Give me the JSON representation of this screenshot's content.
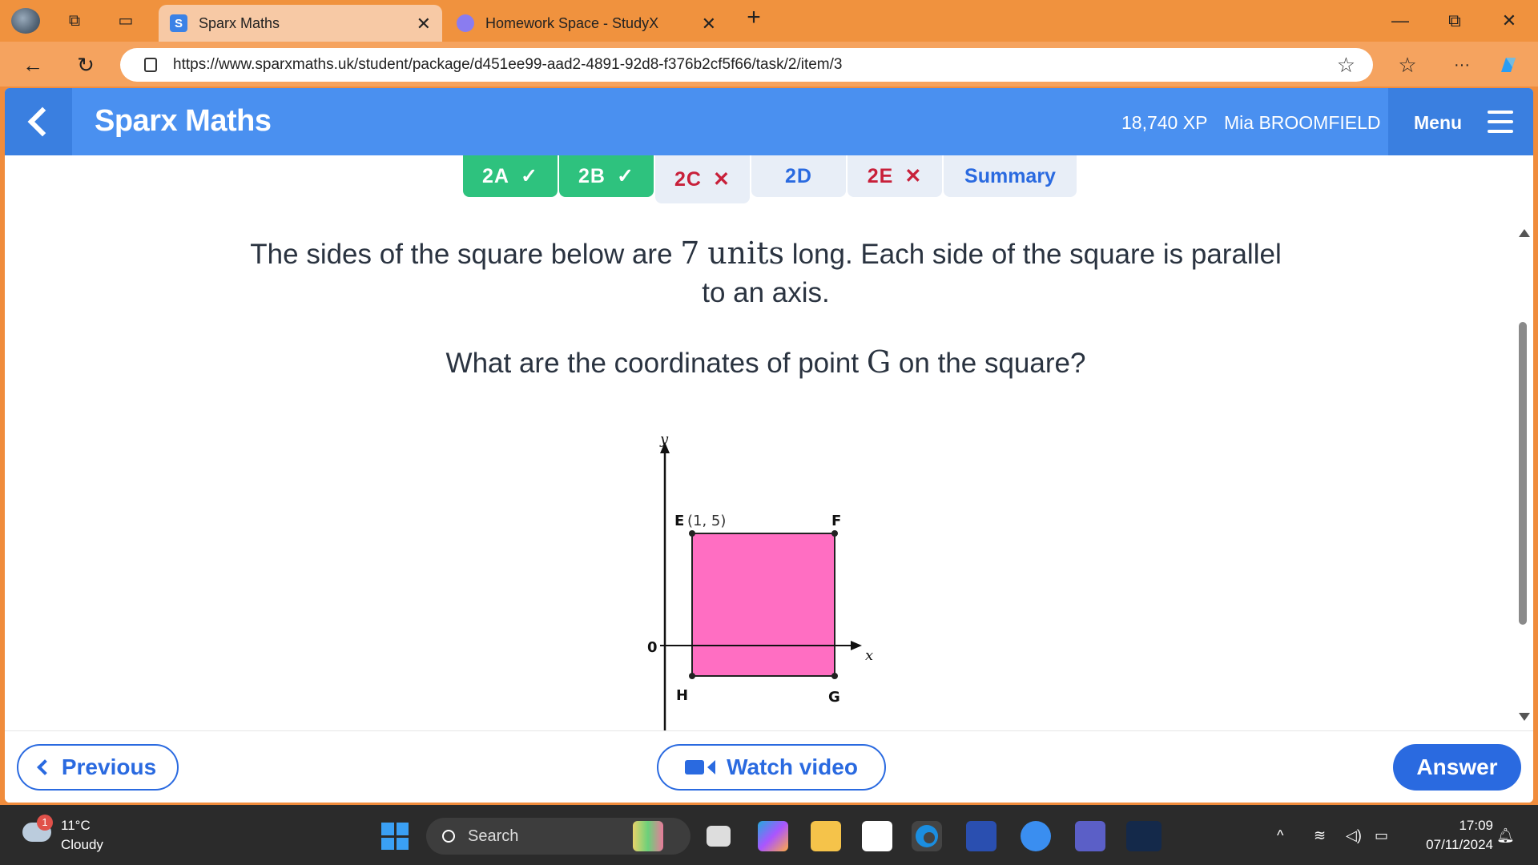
{
  "browser": {
    "tabs": [
      {
        "title": "Sparx Maths",
        "favicon": "S",
        "active": true
      },
      {
        "title": "Homework Space - StudyX",
        "active": false
      }
    ],
    "new_tab": "+",
    "url": "https://www.sparxmaths.uk/student/package/d451ee99-aad2-4891-92d8-f376b2cf5f66/task/2/item/3"
  },
  "app": {
    "brand": "Sparx Maths",
    "xp": "18,740 XP",
    "user": "Mia BROOMFIELD",
    "menu_label": "Menu"
  },
  "task_tabs": [
    {
      "label": "2A",
      "status": "done",
      "mark": "✓"
    },
    {
      "label": "2B",
      "status": "done",
      "mark": "✓"
    },
    {
      "label": "2C",
      "status": "wrong",
      "mark": "✕"
    },
    {
      "label": "2D",
      "status": "plain",
      "mark": ""
    },
    {
      "label": "2E",
      "status": "wrong",
      "mark": "✕"
    },
    {
      "label": "Summary",
      "status": "plain",
      "mark": ""
    }
  ],
  "question": {
    "line1_pre": "The sides of the square below are ",
    "line1_num": "7",
    "line1_unit": "units",
    "line1_post": " long. Each side of the square is parallel",
    "line2": "to an axis.",
    "q_pre": "What are the coordinates of point ",
    "q_point": "G",
    "q_post": " on the square?"
  },
  "diagram": {
    "y_axis": "y",
    "x_axis": "x",
    "origin": "0",
    "label_E": "E",
    "label_E_coord": "(1, 5)",
    "label_F": "F",
    "label_H": "H",
    "label_G": "G",
    "fill_color": "#ff6ec2"
  },
  "buttons": {
    "previous": "Previous",
    "watch_video": "Watch video",
    "answer": "Answer"
  },
  "taskbar": {
    "temp": "11°C",
    "condition": "Cloudy",
    "weather_badge": "1",
    "search_placeholder": "Search",
    "time": "17:09",
    "date": "07/11/2024"
  },
  "colors": {
    "accent": "#4a90f0",
    "done": "#2ec27e",
    "wrong": "#c8203a",
    "button": "#2a6ae0"
  }
}
